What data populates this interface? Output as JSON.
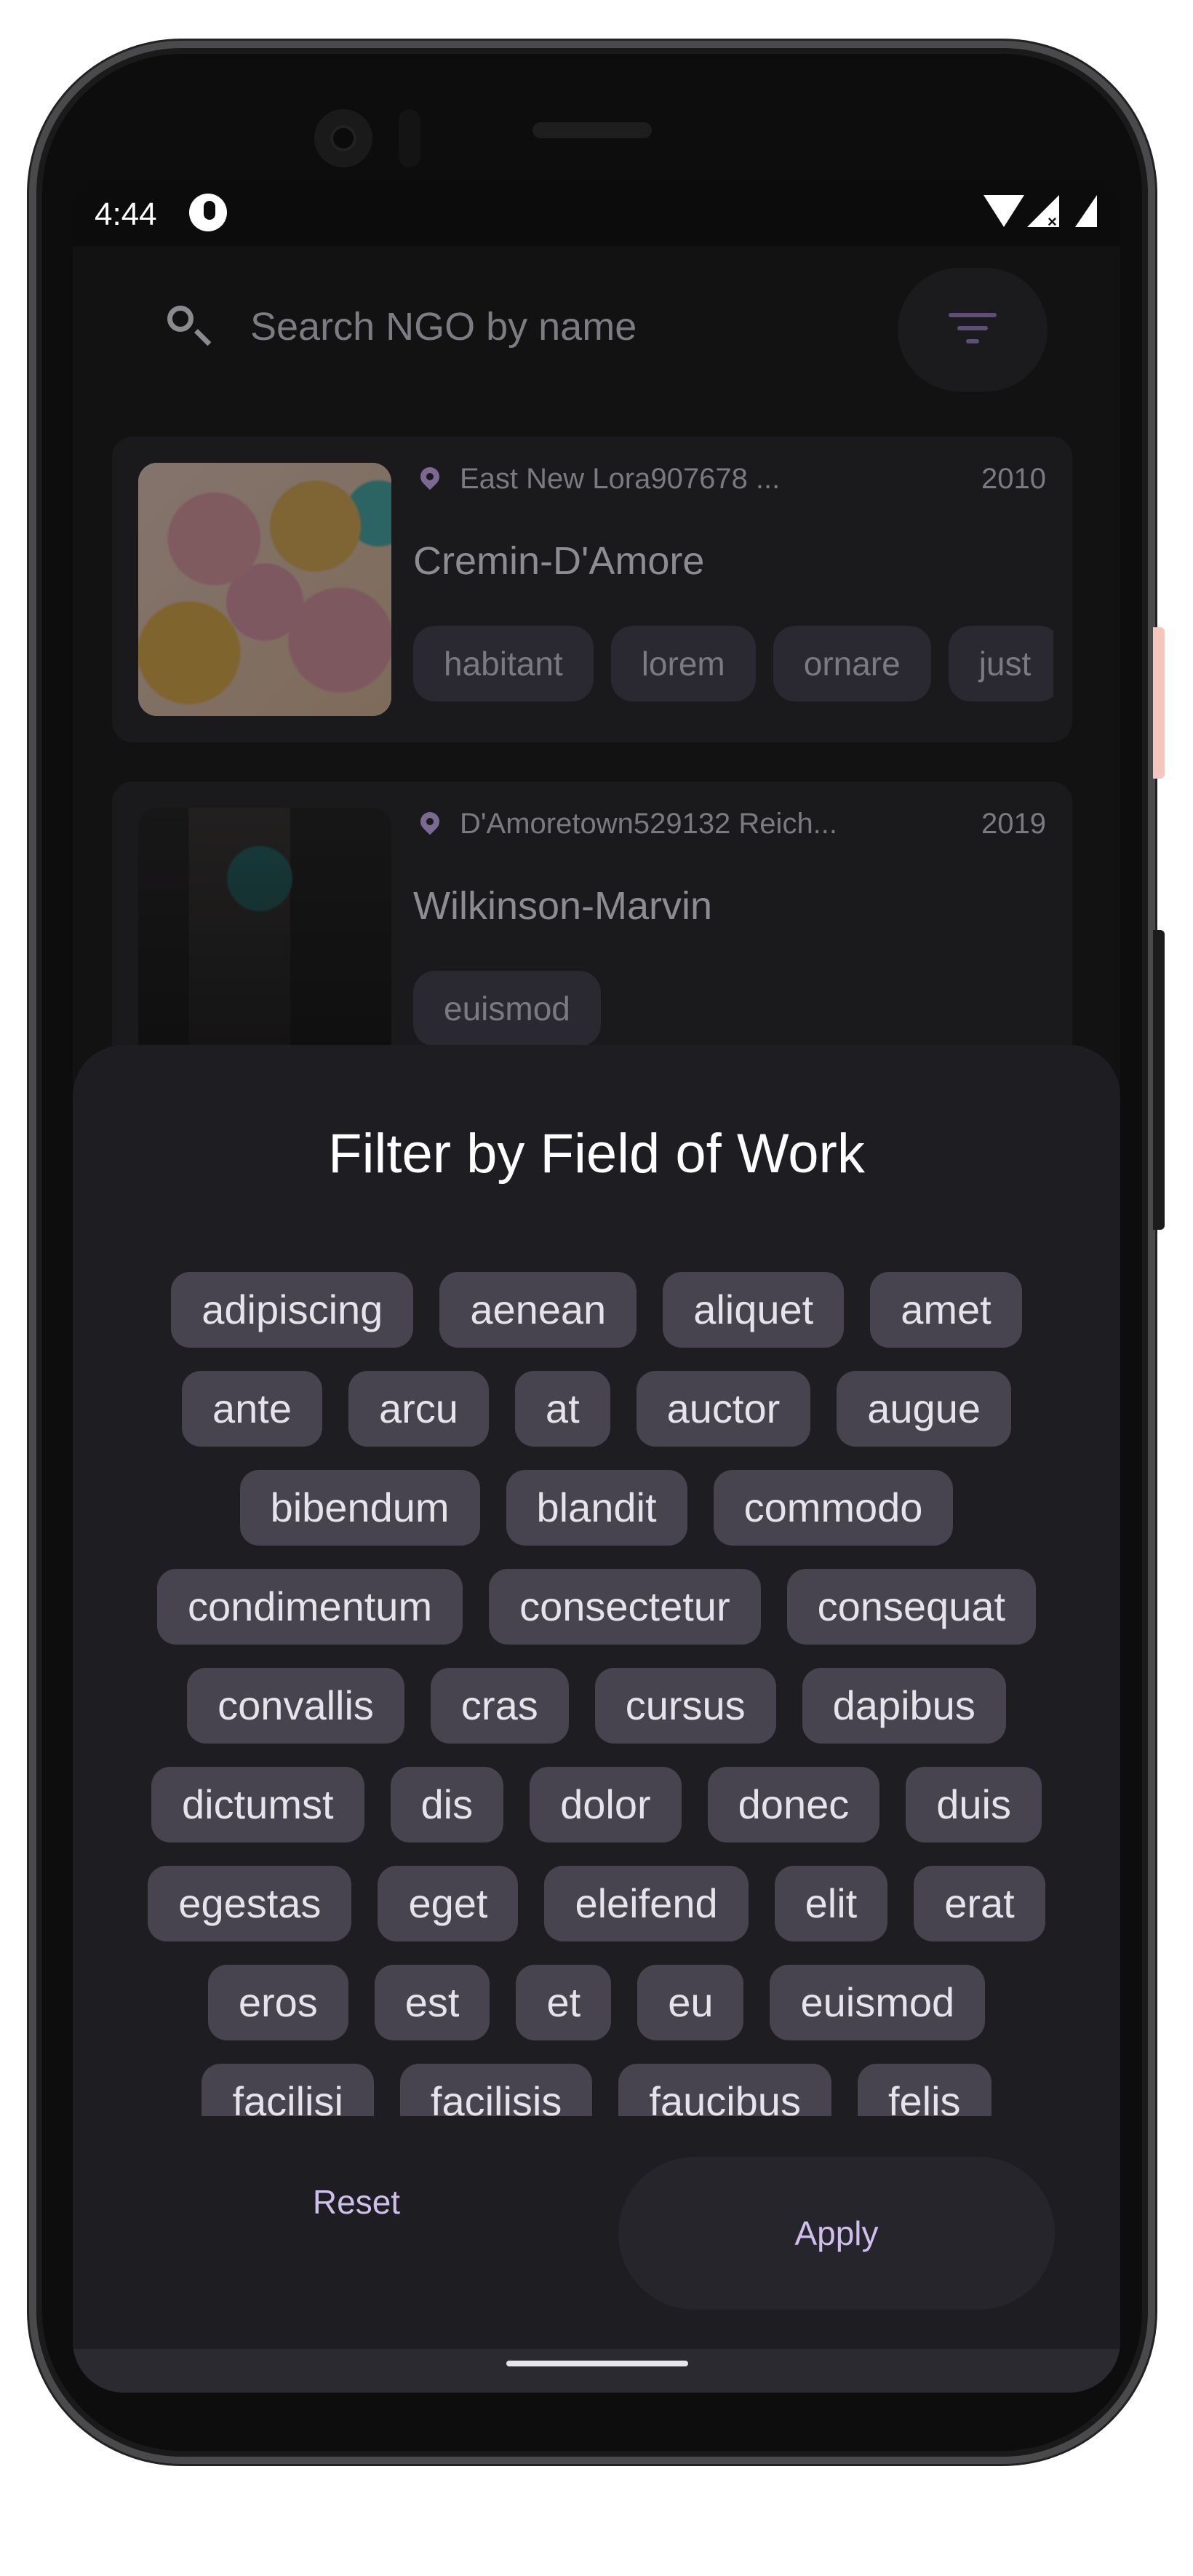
{
  "status_bar": {
    "time": "4:44",
    "icons": [
      "app-status-icon",
      "wifi-icon",
      "cellular-signal-icon",
      "battery-icon"
    ]
  },
  "search": {
    "placeholder": "Search NGO by name",
    "icon": "search-icon",
    "filter_icon": "filter-icon"
  },
  "ngo_list": [
    {
      "location": "East New Lora907678 ...",
      "year": "2010",
      "name": "Cremin-D'Amore",
      "tags": [
        "habitant",
        "lorem",
        "ornare",
        "just"
      ],
      "image": "balloons-photo"
    },
    {
      "location": "D'Amoretown529132 Reich...",
      "year": "2019",
      "name": "Wilkinson-Marvin",
      "tags": [
        "euismod"
      ],
      "image": "night-umbrella-photo"
    }
  ],
  "filter_sheet": {
    "title": "Filter by Field of Work",
    "chip_rows": [
      [
        "adipiscing",
        "aenean",
        "aliquet",
        "amet"
      ],
      [
        "ante",
        "arcu",
        "at",
        "auctor",
        "augue"
      ],
      [
        "bibendum",
        "blandit",
        "commodo"
      ],
      [
        "condimentum",
        "consectetur",
        "consequat"
      ],
      [
        "convallis",
        "cras",
        "cursus",
        "dapibus"
      ],
      [
        "dictumst",
        "dis",
        "dolor",
        "donec",
        "duis"
      ],
      [
        "egestas",
        "eget",
        "eleifend",
        "elit",
        "erat"
      ],
      [
        "eros",
        "est",
        "et",
        "eu",
        "euismod"
      ],
      [
        "facilisi",
        "facilisis",
        "faucibus",
        "felis"
      ]
    ],
    "reset_label": "Reset",
    "apply_label": "Apply"
  },
  "colors": {
    "accent": "#d0bfec",
    "chip_bg": "#47444f",
    "sheet_bg": "#1e1d21"
  }
}
